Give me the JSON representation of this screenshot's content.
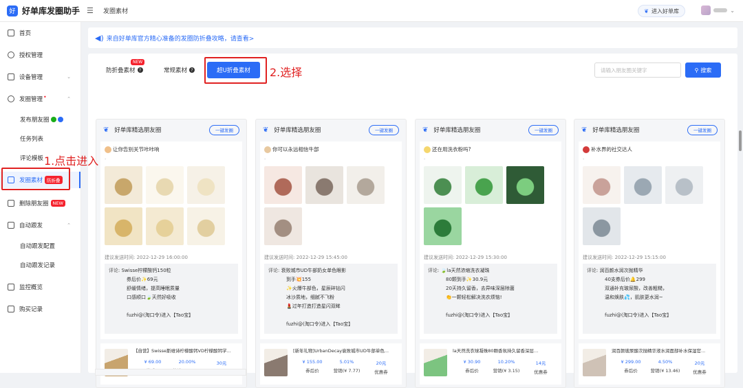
{
  "app": {
    "title": "好单库发圈助手",
    "logo_text": "好",
    "breadcrumb": "发圈素材"
  },
  "topbar": {
    "enter_label": "进入好单库"
  },
  "sidebar": {
    "home": "首页",
    "auth": "授权管理",
    "device": "设备管理",
    "circle": "发圈管理",
    "publish": "发布朋友圈",
    "tasks": "任务列表",
    "comment_tpl": "评论模板",
    "material": "发圈素材",
    "material_badge": "防折叠",
    "delete": "删除朋友圈",
    "delete_badge": "NEW",
    "auto": "自动跟发",
    "auto_cfg": "自动跟发配置",
    "auto_log": "自动跟发记录",
    "monitor": "监控概览",
    "purchase": "购买记录"
  },
  "annotations": {
    "step1": "1.点击进入",
    "step2": "2.选择"
  },
  "notice": {
    "text": "来自好单库官方精心准备的发圈防折叠攻略，请查看>"
  },
  "tabs": {
    "anti_fold": "防折叠素材",
    "anti_fold_badge": "NEW",
    "normal": "常规素材",
    "super": "超U折叠素材"
  },
  "search": {
    "placeholder": "请输入朋友圈关键字",
    "button": "搜索"
  },
  "card_common": {
    "source": "好单库精选朋友圈",
    "send": "一键发圈",
    "comment_label": "评论:"
  },
  "cards": [
    {
      "title": "让你告别关节咔咔响",
      "time": "建议发送时间: 2022-12-29 16:00:00",
      "comment": [
        "Swisse柠檬酸钙150粒",
        "券后价✨69元",
        "舒缓情绪，提高睡眠质量",
        "口感顺口🍃天然好吸收",
        "",
        "fuzhi@(淘口令)进入【Tao宝】"
      ],
      "product": {
        "title": "【自营】Swisse斯维诗柠檬酸钙VD柠檬酸钙学...",
        "price": "¥ 69.00",
        "price_k": "券后价",
        "rate": "20.00%",
        "rate_k": "营销(¥ 13.80)",
        "coupon": "30元",
        "coupon_k": "优惠券"
      }
    },
    {
      "title": "你可以永远相信牛部",
      "time": "建议发送时间: 2022-12-29 15:45:00",
      "comment": [
        "衰败城市UD牛部奶女单色眼影",
        "到手💥155",
        "✨火爆牛部色，星辰碎钻闪",
        "冰沙质地，细腻不飞粉",
        "💄过年打造打造星闪双眸",
        "",
        "fuzhi@(淘口令)进入【Tao宝】"
      ],
      "product": {
        "title": "[新年礼物]UrbanDecay衰败城市UD牛部单色...",
        "price": "¥ 155.00",
        "price_k": "券后价",
        "rate": "5.01%",
        "rate_k": "营销(¥ 7.77)",
        "coupon": "20元",
        "coupon_k": "优惠券"
      }
    },
    {
      "title": "还在用洗衣粉吗?",
      "time": "建议发送时间: 2022-12-29 15:30:00",
      "comment": [
        "🍃la天然浓缩洗衣凝珠",
        "80颗到手✨30.9元",
        "20天持久留香，去异味深层除菌",
        "👏一颗轻松解决洗衣烦恼!",
        "",
        "fuzhi@(淘口令)进入【Tao宝】"
      ],
      "product": {
        "title": "la天然洗衣球凝珠80颗香氛持久留香深层...",
        "price": "¥ 30.90",
        "price_k": "券后价",
        "rate": "10.20%",
        "rate_k": "营销(¥ 3.15)",
        "coupon": "14元",
        "coupon_k": "优惠券"
      }
    },
    {
      "title": "补水界的社交达人",
      "time": "建议发送时间: 2022-12-29 15:15:00",
      "comment": [
        "润百颜水润次抛精华",
        "40支券后价🔔299",
        "双通补充玻尿酸，改善粗糙，",
        "温和焕肤💦，肌肤更水润~",
        "",
        "fuzhi@(淘口令)进入【Tao宝】"
      ],
      "product": {
        "title": "润百颜玻尿酸次抛精华液水润面部补水保湿官...",
        "price": "¥ 299.00",
        "price_k": "券后价",
        "rate": "4.50%",
        "rate_k": "营销(¥ 13.46)",
        "coupon": "20元",
        "coupon_k": "优惠券"
      }
    }
  ],
  "colors": {
    "accent": "#2b6cf6",
    "highlight": "#e02020",
    "new_badge": "#f5222d"
  }
}
